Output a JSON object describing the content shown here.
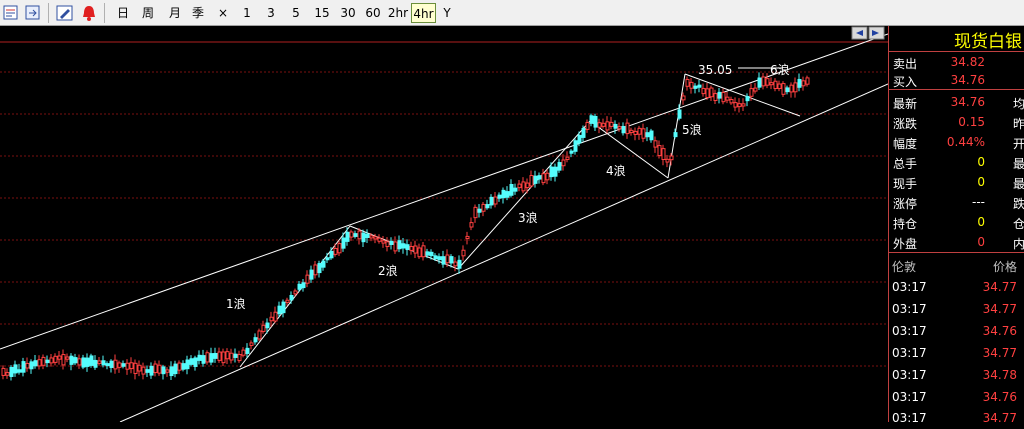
{
  "toolbar": {
    "icons": [
      "chart-settings-icon",
      "export-icon",
      "draw-pen-icon",
      "alarm-bell-icon"
    ],
    "periods": [
      "日",
      "周",
      "月",
      "季",
      "×",
      "1",
      "3",
      "5",
      "15",
      "30",
      "60",
      "2hr",
      "4hr",
      "Y"
    ],
    "active_period": "4hr"
  },
  "chart": {
    "annotations": {
      "wave1": "1浪",
      "wave2": "2浪",
      "wave3": "3浪",
      "wave4": "4浪",
      "wave5": "5浪",
      "wave6": "6浪",
      "high_label": "35.05"
    },
    "colors": {
      "up": "#ff4040",
      "down": "#54fcfc",
      "grid": "#7a1010",
      "trend": "#ffffff"
    }
  },
  "panel": {
    "title": "现货白银",
    "quote": [
      {
        "label": "卖出",
        "value": "34.82",
        "color": "#ff4040",
        "extra": ""
      },
      {
        "label": "买入",
        "value": "34.76",
        "color": "#ff4040",
        "extra": ""
      },
      {
        "label": "最新",
        "value": "34.76",
        "color": "#ff4040",
        "extra": "均"
      },
      {
        "label": "涨跌",
        "value": "0.15",
        "color": "#ff4040",
        "extra": "昨"
      },
      {
        "label": "幅度",
        "value": "0.44%",
        "color": "#ff4040",
        "extra": "开"
      },
      {
        "label": "总手",
        "value": "0",
        "color": "#ffff00",
        "extra": "最"
      },
      {
        "label": "现手",
        "value": "0",
        "color": "#ffff00",
        "extra": "最"
      },
      {
        "label": "涨停",
        "value": "---",
        "color": "#ffffff",
        "extra": "跌"
      },
      {
        "label": "持仓",
        "value": "0",
        "color": "#ffff00",
        "extra": "仓"
      },
      {
        "label": "外盘",
        "value": "0",
        "color": "#ff4040",
        "extra": "内"
      }
    ],
    "ticks_header": {
      "time": "伦敦",
      "price": "价格"
    },
    "ticks": [
      {
        "time": "03:17",
        "price": "34.77"
      },
      {
        "time": "03:17",
        "price": "34.77"
      },
      {
        "time": "03:17",
        "price": "34.76"
      },
      {
        "time": "03:17",
        "price": "34.77"
      },
      {
        "time": "03:17",
        "price": "34.78"
      },
      {
        "time": "03:17",
        "price": "34.76"
      },
      {
        "time": "03:17",
        "price": "34.77"
      }
    ]
  }
}
